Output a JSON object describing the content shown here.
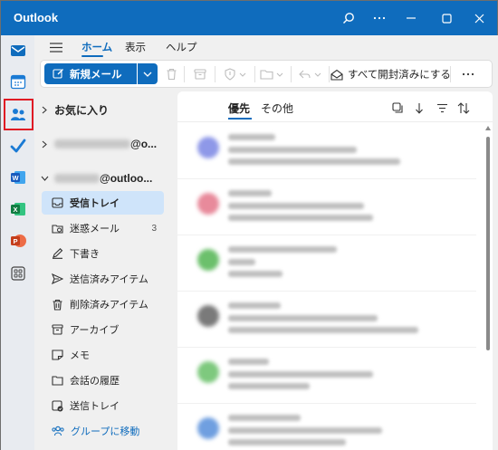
{
  "window": {
    "title": "Outlook",
    "accent": "#0f6cbd"
  },
  "titlebar": {
    "controls": [
      "search-icon",
      "more-icon",
      "minimize-icon",
      "maximize-icon",
      "close-icon"
    ]
  },
  "rail": {
    "items": [
      {
        "name": "mail",
        "icon": "mail-icon"
      },
      {
        "name": "calendar",
        "icon": "calendar-icon"
      },
      {
        "name": "people",
        "icon": "people-icon",
        "highlighted": true
      },
      {
        "name": "todo",
        "icon": "todo-icon"
      },
      {
        "name": "word",
        "icon": "word-icon"
      },
      {
        "name": "excel",
        "icon": "excel-icon"
      },
      {
        "name": "powerpoint",
        "icon": "powerpoint-icon"
      },
      {
        "name": "apps",
        "icon": "apps-icon"
      }
    ],
    "highlight_color": "#e01b24"
  },
  "ribbon": {
    "tabs": [
      "ホーム",
      "表示",
      "ヘルプ"
    ],
    "active_tab": "ホーム",
    "new_mail_label": "新規メール",
    "mark_all_read_label": "すべて開封済みにする"
  },
  "folders": {
    "favorites_label": "お気に入り",
    "account1_suffix": "@o...",
    "account2_suffix": "@outloo...",
    "items": [
      {
        "label": "受信トレイ",
        "icon": "inbox-icon",
        "selected": true,
        "count": ""
      },
      {
        "label": "迷惑メール",
        "icon": "junk-icon",
        "selected": false,
        "count": "3"
      },
      {
        "label": "下書き",
        "icon": "drafts-icon",
        "selected": false,
        "count": ""
      },
      {
        "label": "送信済みアイテム",
        "icon": "sent-icon",
        "selected": false,
        "count": ""
      },
      {
        "label": "削除済みアイテム",
        "icon": "deleted-icon",
        "selected": false,
        "count": ""
      },
      {
        "label": "アーカイブ",
        "icon": "archive-icon",
        "selected": false,
        "count": ""
      },
      {
        "label": "メモ",
        "icon": "notes-icon",
        "selected": false,
        "count": ""
      },
      {
        "label": "会話の履歴",
        "icon": "history-icon",
        "selected": false,
        "count": ""
      },
      {
        "label": "送信トレイ",
        "icon": "outbox-icon",
        "selected": false,
        "count": ""
      }
    ],
    "groups_link": "グループに移動"
  },
  "message_list": {
    "tabs": [
      "優先",
      "その他"
    ],
    "active_tab": "優先",
    "avatar_colors": [
      "#8e98e8",
      "#e88a9b",
      "#6cc06c",
      "#7a7a7a",
      "#7ec97e",
      "#6f9fe0"
    ]
  }
}
